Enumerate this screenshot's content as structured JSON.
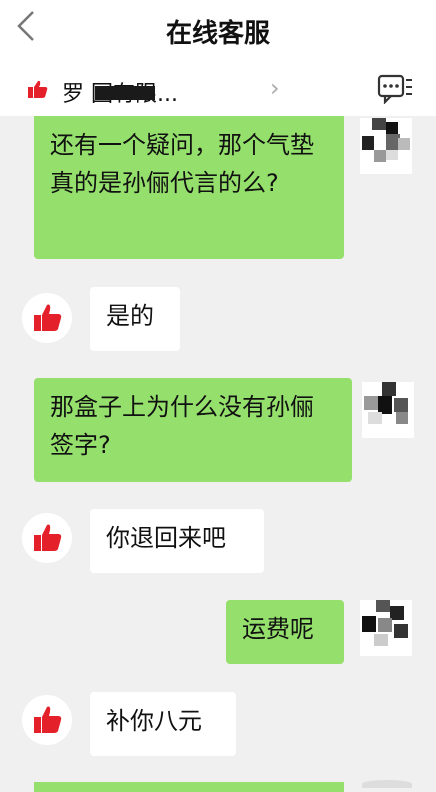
{
  "header": {
    "back_icon": "chevron-left-icon",
    "title": "在线客服"
  },
  "shop_bar": {
    "name": "罗  园有限...",
    "arrow": "›",
    "menu_icon": "chat-menu-icon"
  },
  "messages": [
    {
      "from": "me",
      "text": "还有一个疑问，那个气垫真的是孙俪代言的么?"
    },
    {
      "from": "agent",
      "text": "是的"
    },
    {
      "from": "me",
      "text": "那盒子上为什么没有孙俪签字?"
    },
    {
      "from": "agent",
      "text": "你退回来吧"
    },
    {
      "from": "me",
      "text": "运费呢"
    },
    {
      "from": "agent",
      "text": "补你八元"
    }
  ],
  "colors": {
    "my_bubble": "#95e06c",
    "agent_bubble": "#ffffff",
    "thumb_red": "#e4202b",
    "background": "#f0f0f0"
  }
}
